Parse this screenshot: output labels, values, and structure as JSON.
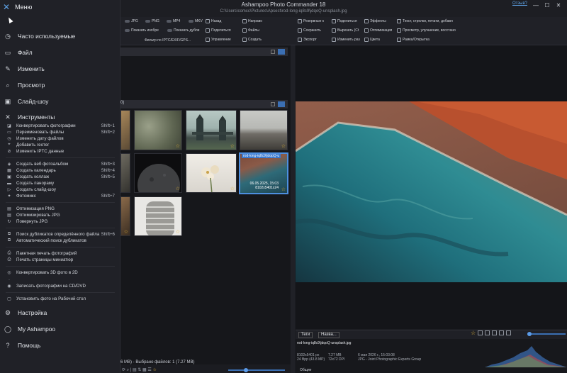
{
  "app": {
    "title": "Ashampoo Photo Commander 18",
    "path": "C:\\Users\\comcc\\Pictures\\Apsest\\rod-long-iq8c9\\jdqoQ-unsplash.jpg",
    "feedback": "Отзыв?"
  },
  "ribbon": {
    "formats": [
      "JPG",
      "PNG",
      "MP4",
      "MKV"
    ],
    "show_images": "Показать изобре",
    "show_duplicates": "Показать дубли",
    "filter_label": "Фильтр по IPTC/EXIF/GPS...",
    "col1": [
      "Назад",
      "Поделиться",
      "Управление"
    ],
    "col2": [
      "Направо",
      "Файлы",
      "Создать"
    ],
    "col3": [
      "Резервные к",
      "Сохранить",
      "Экспорт"
    ],
    "col4": [
      "Поделиться",
      "Вырезать (Ct",
      "Изменить раз"
    ],
    "col5": [
      "Эффекты",
      "Оптимизация",
      "Цвета"
    ],
    "col6": [
      "Текст, стрелки, печати, добавл",
      "Просмотр, улучшение, восстано",
      "Рамка/Открытка"
    ]
  },
  "browser": {
    "group_count": "0)",
    "selected_name": "rod-long-iq8c9\\jdqoQ-u",
    "selected_date": "06.05.2025, 15:03",
    "selected_size": "8102x5401x24",
    "status": "6 MB) - Выбрано файлов: 1 (7.27 MB)"
  },
  "info": {
    "tab_tags": "Теги",
    "tab_name": "Назва...",
    "filename": "rod-long-iq8c9\\jdqoQ-unsplash.jpg",
    "dims": "8102x5401 px",
    "bpp": "24 Bpp (43.8 MP)",
    "size": "7.27 MB",
    "dpi": "72x72 DPI",
    "date": "6 мая 2026 г., 15:03:08",
    "type": "JPG - Joint Photographic Experts Group",
    "footer": "Общие"
  },
  "menu": {
    "title": "Меню",
    "top_items": [
      {
        "icon": "clock-icon",
        "glyph": "◷",
        "label": "Часто используемые"
      },
      {
        "icon": "folder-icon",
        "glyph": "▭",
        "label": "Файл"
      },
      {
        "icon": "pencil-icon",
        "glyph": "✎",
        "label": "Изменить"
      },
      {
        "icon": "magnifier-icon",
        "glyph": "⌕",
        "label": "Просмотр"
      },
      {
        "icon": "slideshow-icon",
        "glyph": "▣",
        "label": "Слайд-шоу"
      },
      {
        "icon": "tools-icon",
        "glyph": "✕",
        "label": "Инструменты"
      }
    ],
    "tools_items": [
      {
        "icon": "convert-icon",
        "label": "Конвертировать фотографии",
        "shortcut": "Shift+1"
      },
      {
        "icon": "rename-icon",
        "label": "Переименовать файлы",
        "shortcut": "Shift+2"
      },
      {
        "icon": "clock-edit-icon",
        "label": "Изменить дату файлов",
        "shortcut": ""
      },
      {
        "icon": "pin-icon",
        "label": "Добавить геотег",
        "shortcut": ""
      },
      {
        "icon": "tag-icon",
        "label": "Изменить IPTC данные",
        "shortcut": ""
      },
      {
        "icon": "web-album-icon",
        "label": "Создать веб фотоальбом",
        "shortcut": "Shift+3"
      },
      {
        "icon": "calendar-icon",
        "label": "Создать календарь",
        "shortcut": "Shift+4"
      },
      {
        "icon": "collage-icon",
        "label": "Создать коллаж",
        "shortcut": "Shift+5"
      },
      {
        "icon": "panorama-icon",
        "label": "Создать панораму",
        "shortcut": ""
      },
      {
        "icon": "slideshow-create-icon",
        "label": "Создать слайд-шоу",
        "shortcut": ""
      },
      {
        "icon": "photomix-icon",
        "label": "Фотомикс",
        "shortcut": "Shift+7"
      },
      {
        "icon": "png-icon",
        "label": "Оптимизация PNG",
        "shortcut": ""
      },
      {
        "icon": "jpg-icon",
        "label": "Оптимизировать JPG",
        "shortcut": ""
      },
      {
        "icon": "rotate-icon",
        "label": "Повернуть JPG",
        "shortcut": ""
      },
      {
        "icon": "duplicates-icon",
        "label": "Поиск дубликатов определённого файла",
        "shortcut": "Shift+6"
      },
      {
        "icon": "auto-duplicates-icon",
        "label": "Автоматический поиск дубликатов",
        "shortcut": ""
      },
      {
        "icon": "batch-print-icon",
        "label": "Пакетная печать фотографий",
        "shortcut": ""
      },
      {
        "icon": "print-thumbs-icon",
        "label": "Печать страницы миниатюр",
        "shortcut": ""
      },
      {
        "icon": "convert-3d-icon",
        "label": "Конвертировать 3D фото в 2D",
        "shortcut": ""
      },
      {
        "icon": "disabled-icon",
        "label": "",
        "shortcut": ""
      },
      {
        "icon": "cd-icon",
        "label": "Записать фотографии на CD/DVD",
        "shortcut": ""
      },
      {
        "icon": "wallpaper-icon",
        "label": "Установить фото на Рабочий стол",
        "shortcut": ""
      }
    ],
    "bottom_items": [
      {
        "icon": "gear-icon",
        "glyph": "⚙",
        "label": "Настройка"
      },
      {
        "icon": "user-icon",
        "glyph": "◯",
        "label": "My Ashampoo"
      },
      {
        "icon": "help-icon",
        "glyph": "?",
        "label": "Помощь"
      }
    ]
  }
}
